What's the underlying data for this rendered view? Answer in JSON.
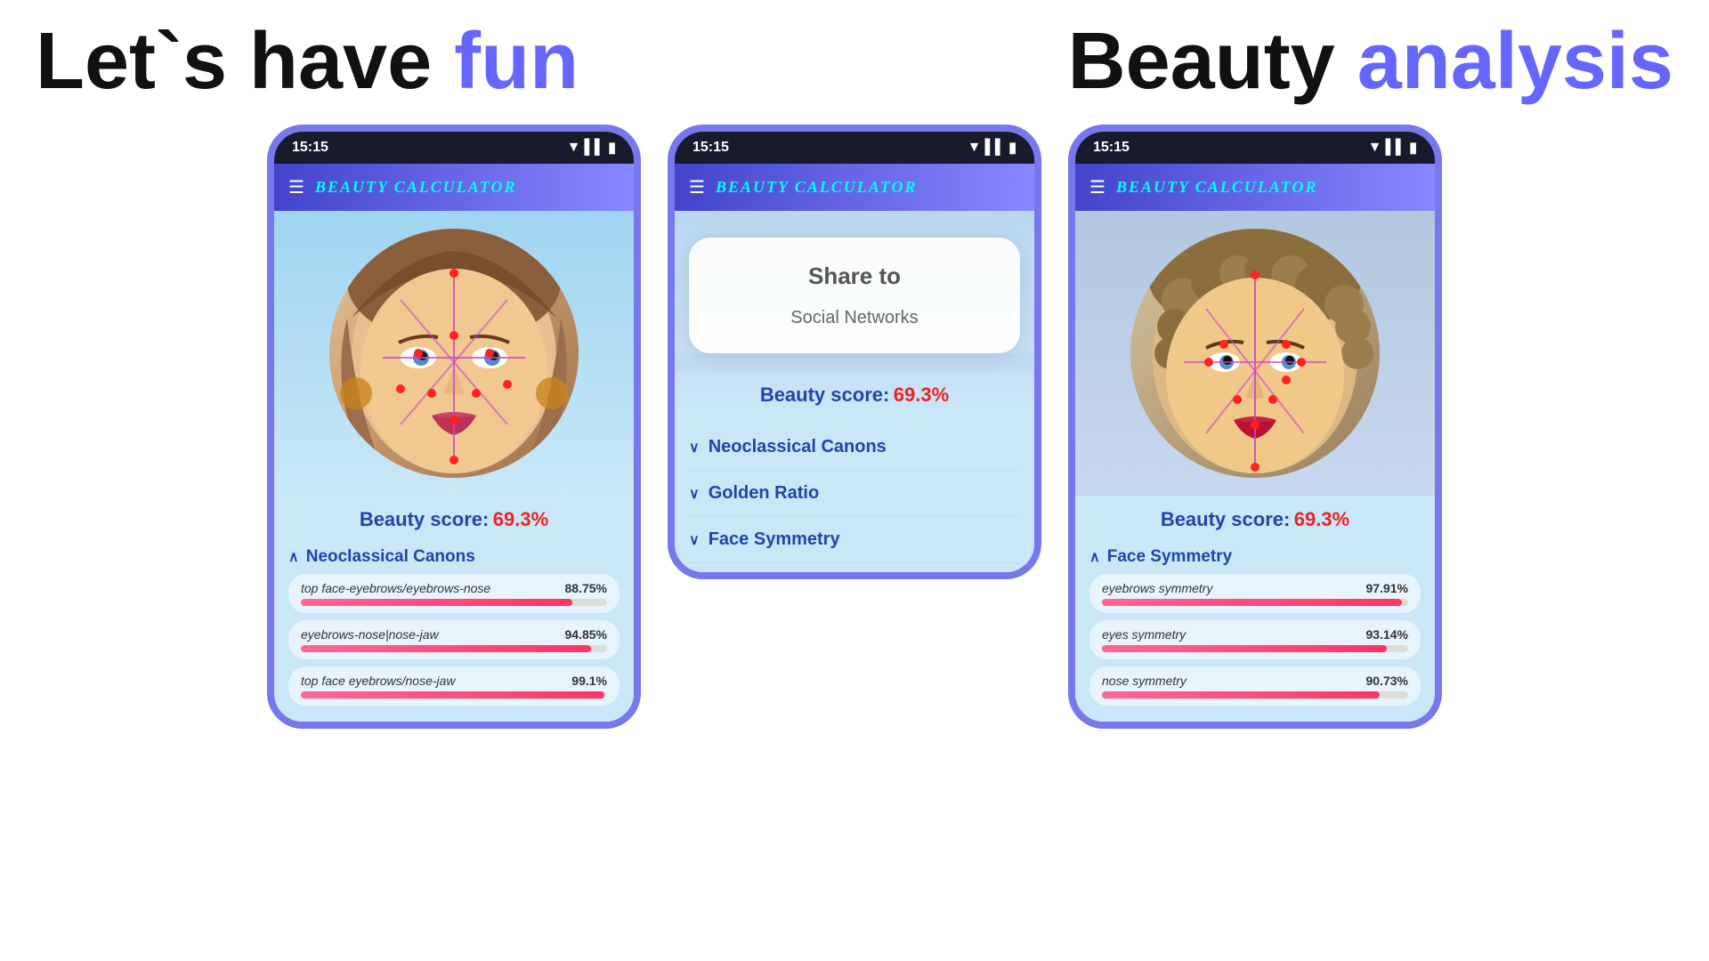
{
  "header": {
    "left_part1": "Let`s  have ",
    "left_fun": "fun",
    "right_part1": "Beauty ",
    "right_analysis": "analysis"
  },
  "phones": [
    {
      "id": "phone-left",
      "status_time": "15:15",
      "app_title": "BEAUTY CALCULATOR",
      "face_description": "Woman face with measurement lines",
      "beauty_score_label": "Beauty score:",
      "beauty_score_value": "69.3%",
      "section_label": "Neoclassical Canons",
      "section_open": true,
      "stats": [
        {
          "label": "top face-eyebrows/eyebrows-nose",
          "value": "88.75%",
          "fill": 88.75
        },
        {
          "label": "eyebrows-nose|nose-jaw",
          "value": "94.85%",
          "fill": 94.85
        },
        {
          "label": "top face eyebrows/nose-jaw",
          "value": "99.1%",
          "fill": 99.1
        }
      ]
    },
    {
      "id": "phone-middle",
      "status_time": "15:15",
      "app_title": "BEAUTY CALCULATOR",
      "share_title": "Share to",
      "share_option": "Social Networks",
      "beauty_score_label": "Beauty score:",
      "beauty_score_value": "69.3%",
      "sections": [
        {
          "label": "Neoclassical Canons",
          "open": false
        },
        {
          "label": "Golden Ratio",
          "open": false
        },
        {
          "label": "Face Symmetry",
          "open": false
        }
      ]
    },
    {
      "id": "phone-right",
      "status_time": "15:15",
      "app_title": "BEAUTY CALCULATOR",
      "face_description": "Woman face with measurement lines",
      "beauty_score_label": "Beauty score:",
      "beauty_score_value": "69.3%",
      "section_label": "Face Symmetry",
      "section_open": true,
      "stats": [
        {
          "label": "eyebrows symmetry",
          "value": "97.91%",
          "fill": 97.91
        },
        {
          "label": "eyes symmetry",
          "value": "93.14%",
          "fill": 93.14
        },
        {
          "label": "nose symmetry",
          "value": "90.73%",
          "fill": 90.73
        }
      ]
    }
  ]
}
